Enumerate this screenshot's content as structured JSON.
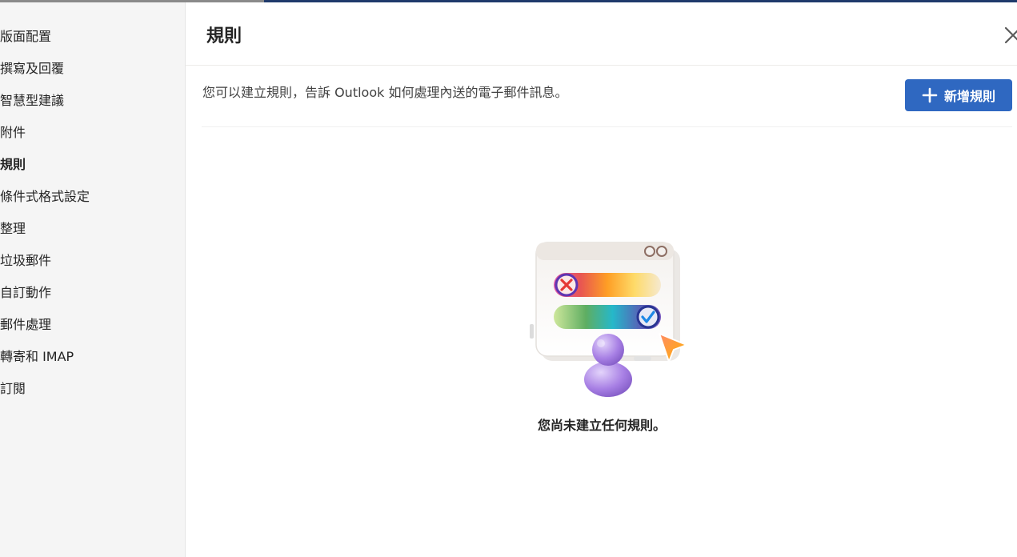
{
  "sidebar": {
    "items": [
      {
        "label": "版面配置"
      },
      {
        "label": "撰寫及回覆"
      },
      {
        "label": "智慧型建議"
      },
      {
        "label": "附件"
      },
      {
        "label": "規則",
        "selected": true
      },
      {
        "label": "條件式格式設定"
      },
      {
        "label": "整理"
      },
      {
        "label": "垃圾郵件"
      },
      {
        "label": "自訂動作"
      },
      {
        "label": "郵件處理"
      },
      {
        "label": "轉寄和 IMAP"
      },
      {
        "label": "訂閱"
      }
    ]
  },
  "panel": {
    "title": "規則",
    "close_icon": "close-icon",
    "description": "您可以建立規則，告訴 Outlook 如何處理內送的電子郵件訊息。",
    "add_rule_label": "新增規則",
    "add_rule_icon": "plus-icon",
    "empty_state_text": "您尚未建立任何規則。"
  },
  "colors": {
    "accent": "#2f68c1",
    "sidebar_bg": "#f5f5f5",
    "topbar": "#1f3a6b"
  }
}
